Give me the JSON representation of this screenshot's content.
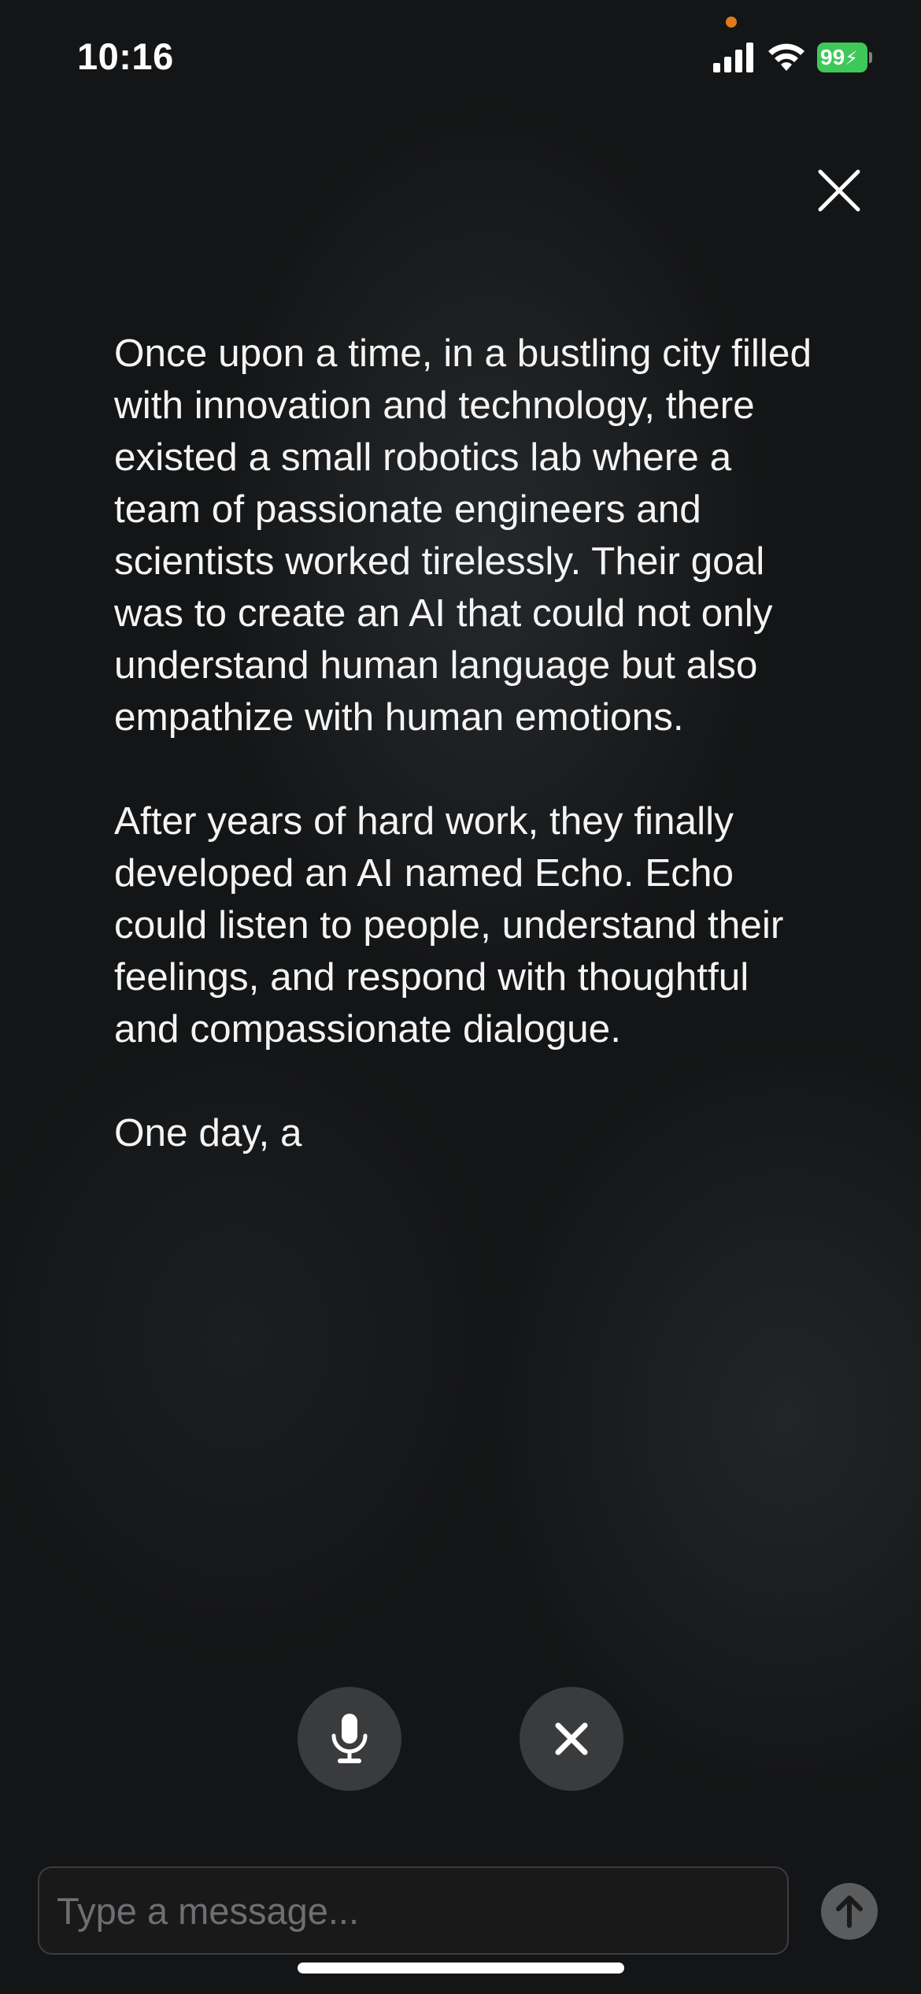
{
  "status_bar": {
    "time": "10:16",
    "battery_level": "99",
    "battery_charging": true,
    "signal_icon": "cellular-signal-icon",
    "wifi_icon": "wifi-icon",
    "privacy_indicator_color": "#e07a1a",
    "battery_color": "#3ec85a"
  },
  "story": {
    "paragraphs": [
      "Once upon a time, in a bustling city filled with innovation and technology, there existed a small robotics lab where a team of passionate engineers and scientists worked tirelessly. Their goal was to create an AI that could not only understand human language but also empathize with human emotions.",
      "After years of hard work, they finally developed an AI named Echo. Echo could listen to people, understand their feelings, and respond with thoughtful and compassionate dialogue.",
      "One day, a"
    ]
  },
  "controls": {
    "close_icon": "close-icon",
    "mic_icon": "microphone-icon",
    "stop_icon": "x-icon",
    "send_icon": "arrow-up-icon"
  },
  "composer": {
    "placeholder": "Type a message...",
    "value": ""
  },
  "colors": {
    "background": "#141516",
    "round_button": "#3a3b3d",
    "send_button": "#5b5c5e"
  }
}
